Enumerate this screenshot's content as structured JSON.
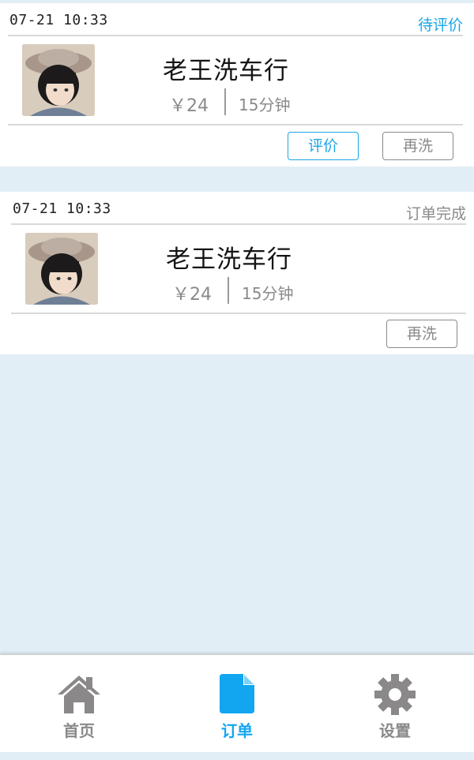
{
  "orders": [
    {
      "time": "07-21  10:33",
      "status": "待评价",
      "shop_name": "老王洗车行",
      "price": "￥24",
      "duration": "15分钟",
      "buttons": {
        "rate": "评价",
        "rewash": "再洗"
      }
    },
    {
      "time": "07-21  10:33",
      "status": "订单完成",
      "shop_name": "老王洗车行",
      "price": "￥24",
      "duration": "15分钟",
      "buttons": {
        "rewash": "再洗"
      }
    }
  ],
  "tabbar": {
    "items": [
      {
        "label": "首页",
        "icon": "home-icon",
        "active": false
      },
      {
        "label": "订单",
        "icon": "document-icon",
        "active": true
      },
      {
        "label": "设置",
        "icon": "gear-icon",
        "active": false
      }
    ]
  },
  "colors": {
    "accent": "#1aa6e8",
    "background": "#e2eef5",
    "muted_text": "#8a8a8a",
    "tab_active": "#12a6f0",
    "tab_inactive": "#8a8888"
  }
}
